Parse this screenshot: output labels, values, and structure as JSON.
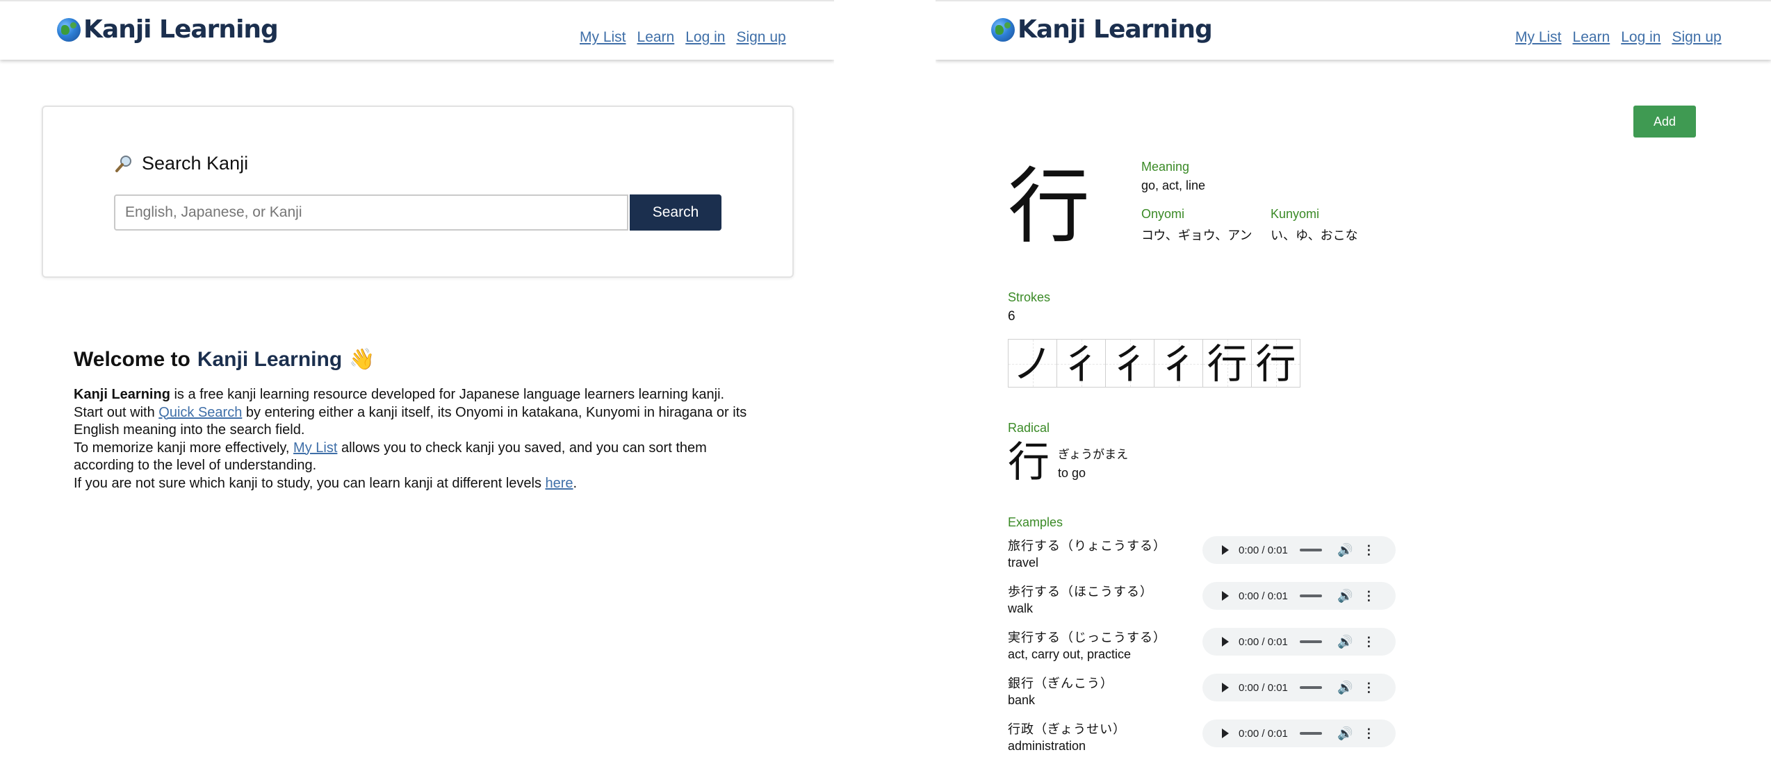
{
  "brand": {
    "name": "Kanji Learning",
    "logo_icon": "globe-icon"
  },
  "nav": {
    "my_list": "My List",
    "learn": "Learn",
    "log_in": "Log in",
    "sign_up": "Sign up"
  },
  "search": {
    "title": "Search Kanji",
    "icon": "magnifier-icon",
    "placeholder": "English, Japanese, or Kanji",
    "button": "Search"
  },
  "welcome": {
    "prefix": "Welcome to",
    "brand": "Kanji Learning",
    "emoji": "👋",
    "line1_bold": "Kanji Learning",
    "line1_rest": " is a free kanji learning resource developed for Japanese language learners learning kanji.",
    "line2_pre": "Start out with ",
    "line2_link": "Quick Search",
    "line2_post": " by entering either a kanji itself, its Onyomi in katakana, Kunyomi in hiragana or its English meaning into the search field.",
    "line3_pre": "To memorize kanji more effectively, ",
    "line3_link": "My List",
    "line3_post": " allows you to check kanji you saved, and you can sort them according to the level of understanding.",
    "line4_pre": "If you are not sure which kanji to study, you can learn kanji at different levels ",
    "line4_link": "here",
    "line4_post": "."
  },
  "kanji": {
    "add_button": "Add",
    "character": "行",
    "meaning_label": "Meaning",
    "meaning": "go, act, line",
    "onyomi_label": "Onyomi",
    "onyomi": "コウ、ギョウ、アン",
    "kunyomi_label": "Kunyomi",
    "kunyomi": "い、ゆ、おこな",
    "strokes_label": "Strokes",
    "strokes": "6",
    "stroke_steps": [
      "ノ",
      "彳",
      "彳",
      "彳",
      "行",
      "行"
    ],
    "radical_label": "Radical",
    "radical": "行",
    "radical_reading": "ぎょうがまえ",
    "radical_meaning": "to go",
    "examples_label": "Examples",
    "examples": [
      {
        "word": "旅行する（りょこうする）",
        "meaning": "travel",
        "time": "0:00 / 0:01"
      },
      {
        "word": "歩行する（ほこうする）",
        "meaning": "walk",
        "time": "0:00 / 0:01"
      },
      {
        "word": "実行する（じっこうする）",
        "meaning": "act, carry out, practice",
        "time": "0:00 / 0:01"
      },
      {
        "word": "銀行（ぎんこう）",
        "meaning": "bank",
        "time": "0:00 / 0:01"
      },
      {
        "word": "行政（ぎょうせい）",
        "meaning": "administration",
        "time": "0:00 / 0:01"
      }
    ]
  }
}
